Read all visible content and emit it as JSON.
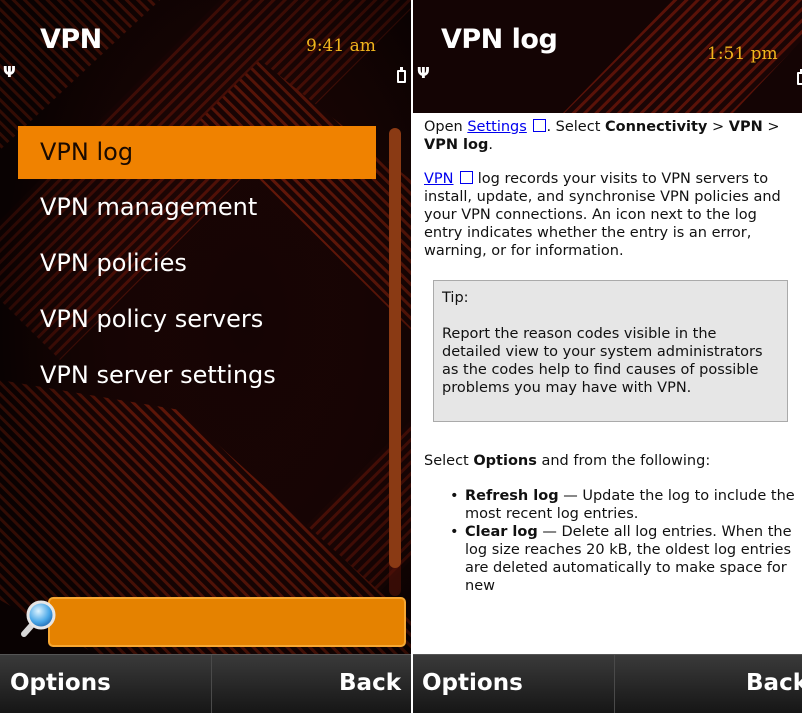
{
  "left": {
    "title": "VPN",
    "time": "9:41 am",
    "menu": [
      {
        "label": "VPN log",
        "selected": true
      },
      {
        "label": "VPN management",
        "selected": false
      },
      {
        "label": "VPN policies",
        "selected": false
      },
      {
        "label": "VPN policy servers",
        "selected": false
      },
      {
        "label": "VPN server settings",
        "selected": false
      }
    ],
    "search_value": "",
    "softkeys": {
      "left": "Options",
      "right": "Back"
    }
  },
  "right": {
    "title": "VPN log",
    "time": "1:51 pm",
    "para1": {
      "open": "Open ",
      "settings_link": "Settings",
      "select": ". Select ",
      "connectivity": "Connectivity",
      "sep1": " > ",
      "vpn": "VPN",
      "sep2": " > ",
      "vpn_log": "VPN log",
      "end": "."
    },
    "para2": {
      "vpn_link": "VPN",
      "text": " log records your visits to VPN servers to install, update, and synchronise VPN policies and your VPN connections. An icon next to the log entry indicates whether the entry is an error, warning, or for information."
    },
    "tip": {
      "title": "Tip:",
      "body": "Report the reason codes visible in the detailed view to your system administrators as the codes help to find causes of possible problems you may have with VPN."
    },
    "options_intro": {
      "pre": "Select ",
      "options": "Options",
      "post": " and from the following:"
    },
    "bullets": [
      {
        "term": "Refresh log",
        "desc": " — Update the log to include the most recent log entries."
      },
      {
        "term": "Clear log",
        "desc": " — Delete all log entries. When the log size reaches 20 kB, the oldest log entries are deleted automatically to make space for new"
      }
    ],
    "softkeys": {
      "left": "Options",
      "right": "Back"
    }
  },
  "colors": {
    "highlight": "#f08200",
    "time": "#f2b61d",
    "link": "#0000ee",
    "tip_bg": "#e6e6e6"
  }
}
